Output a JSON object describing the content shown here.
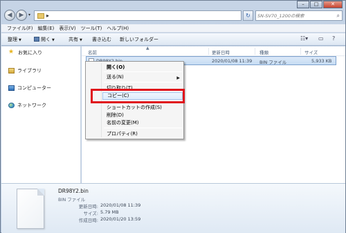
{
  "window": {
    "address": "▸",
    "search_placeholder": "SN-SV70_1200の検索",
    "controls": {
      "minimize": "–",
      "maximize": "□",
      "close": "✕"
    }
  },
  "menubar": [
    "ファイル(F)",
    "編集(E)",
    "表示(V)",
    "ツール(T)",
    "ヘルプ(H)"
  ],
  "toolbar": {
    "organize": "整理",
    "open": "開く",
    "share": "共有",
    "burn": "書き込む",
    "new_folder": "新しいフォルダー"
  },
  "navpane": {
    "favorites": "お気に入り",
    "libraries": "ライブラリ",
    "computer": "コンピューター",
    "network": "ネットワーク"
  },
  "columns": {
    "name": "名前",
    "modified": "更新日時",
    "type": "種類",
    "size": "サイズ"
  },
  "file": {
    "name": "DR98Y2.bin",
    "modified": "2020/01/08 11:39",
    "type": "BIN ファイル",
    "size": "5,933 KB"
  },
  "context_menu": {
    "open": "開く(O)",
    "send_to": "送る(N)",
    "cut": "切り取り(T)",
    "copy": "コピー(C)",
    "create_shortcut": "ショートカットの作成(S)",
    "delete": "削除(D)",
    "rename": "名前の変更(M)",
    "properties": "プロパティ(R)"
  },
  "details": {
    "filename": "DR98Y2.bin",
    "type": "BIN ファイル",
    "modified_label": "更新日時:",
    "modified_value": "2020/01/08 11:39",
    "size_label": "サイズ:",
    "size_value": "5.79 MB",
    "created_label": "作成日時:",
    "created_value": "2020/01/20 13:59"
  },
  "highlight_color": "#e0111b",
  "selection_color": "#c6dcf3"
}
